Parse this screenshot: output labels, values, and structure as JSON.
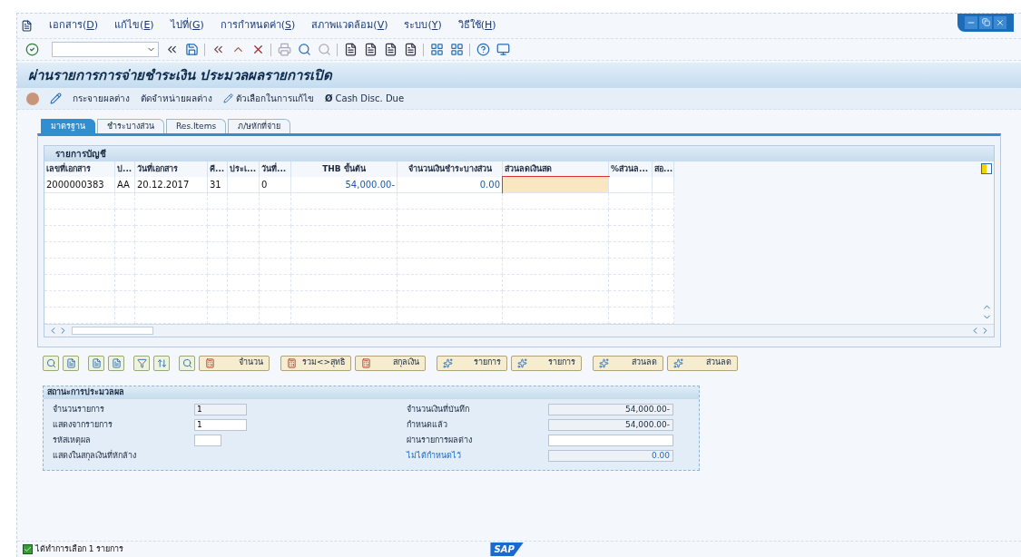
{
  "menu": [
    {
      "label": "เอกสาร(D)"
    },
    {
      "label": "แก้ไข(E)"
    },
    {
      "label": "ไปที่(G)"
    },
    {
      "label": "การกำหนดค่า(S)"
    },
    {
      "label": "สภาพแวดล้อม(V)"
    },
    {
      "label": "ระบบ(Y)"
    },
    {
      "label": "วิธีใช้(H)"
    }
  ],
  "title": "ผ่านรายการการจ่ายชำระเงิน ประมวลผลรายการเปิด",
  "app_toolbar": [
    {
      "label": "กระจายผลต่าง",
      "kind": "text"
    },
    {
      "label": "ตัดจำหน่ายผลต่าง",
      "kind": "text"
    },
    {
      "label": "ตัวเลือกในการแก้ไข",
      "kind": "pencil"
    },
    {
      "label": "Cash Disc. Due",
      "kind": "symbol",
      "symbol": "Ø"
    }
  ],
  "tabs": [
    {
      "label": "มาตรฐาน",
      "selected": true
    },
    {
      "label": "ชำระบางส่วน",
      "selected": false
    },
    {
      "label": "Res.Items",
      "selected": false
    },
    {
      "label": "ภ/ษหักที่จ่าย",
      "selected": false
    }
  ],
  "table": {
    "title": "รายการบัญชี",
    "columns": [
      "เลขที่เอกสาร",
      "ป...",
      "วันที่เอกสาร",
      "คี...",
      "ประเ...",
      "วันที่...",
      "THB ขั้นต้น",
      "จำนวนเงินชำระบางส่วน",
      "ส่วนลดเงินสด",
      "%ส่วนล...",
      "สอ..."
    ],
    "rows": [
      {
        "cells": [
          {
            "text": "2000000383",
            "focused": false
          },
          {
            "text": "AA",
            "focused": false
          },
          {
            "text": "20.12.2017",
            "focused": false
          },
          {
            "text": "31",
            "focused": false
          },
          {
            "text": "",
            "focused": false
          },
          {
            "text": "0",
            "focused": false
          },
          {
            "text": "54,000.00-",
            "focused": false
          },
          {
            "text": "0.00",
            "focused": false
          },
          {
            "text": "",
            "focused": true
          },
          {
            "text": "",
            "focused": false
          },
          {
            "text": "",
            "focused": false
          }
        ]
      }
    ]
  },
  "buttons": [
    {
      "kind": "icon"
    },
    {
      "kind": "icon"
    },
    {
      "kind": "icon"
    },
    {
      "kind": "icon"
    },
    {
      "kind": "icon"
    },
    {
      "kind": "icon"
    },
    {
      "kind": "icon"
    },
    {
      "kind": "labeled",
      "label": "จำนวน"
    },
    {
      "kind": "labeled",
      "label": "รวม<>สุทธิ"
    },
    {
      "kind": "labeled",
      "label": "สกุลเงิน"
    },
    {
      "kind": "labeled",
      "label": "รายการ"
    },
    {
      "kind": "labeled",
      "label": "รายการ"
    },
    {
      "kind": "labeled",
      "label": "ส่วนลด"
    },
    {
      "kind": "labeled",
      "label": "ส่วนลด"
    }
  ],
  "status_group": {
    "title": "สถานะการประมวลผล",
    "left": [
      {
        "label": "จำนวนรายการ",
        "value": "1",
        "kind": "readonly"
      },
      {
        "label": "แสดงจากรายการ",
        "value": "1",
        "kind": "input"
      },
      {
        "label": "รหัสเหตุผล",
        "kind": "small"
      },
      {
        "label": "แสดงในสกุลเงินที่หักล้าง",
        "kind": "none"
      }
    ],
    "right": [
      {
        "label": "จำนวนเงินที่บันทึก",
        "value": "54,000.00-",
        "kind": "readonly",
        "highlight": false
      },
      {
        "label": "กำหนดแล้ว",
        "value": "54,000.00-",
        "kind": "readonly",
        "highlight": false
      },
      {
        "label": "ผ่านรายการผลต่าง",
        "kind": "input",
        "highlight": false
      },
      {
        "label": "ไม่ได้กำหนดไว้",
        "value": "0.00",
        "kind": "readonly",
        "highlight": true
      }
    ]
  },
  "status_bar": {
    "message": "ได้ทำการเลือก 1 รายการ",
    "logo": "SAP"
  }
}
